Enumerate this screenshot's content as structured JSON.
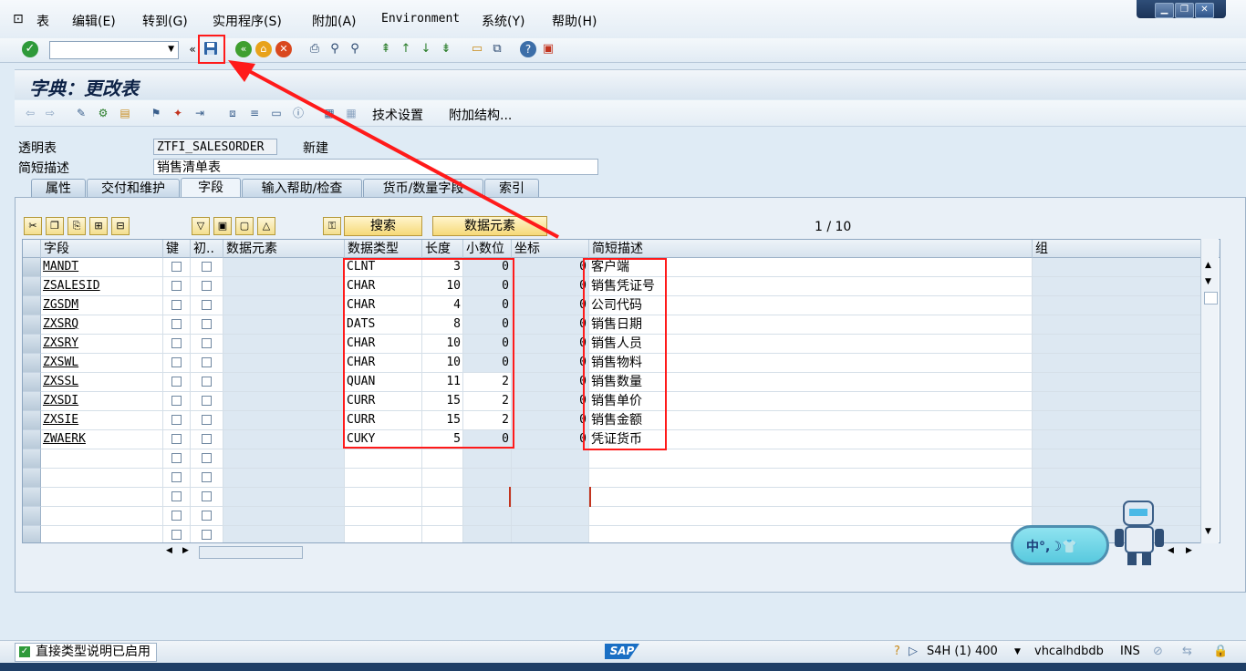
{
  "menubar": {
    "items": [
      "表",
      "编辑(E)",
      "转到(G)",
      "实用程序(S)",
      "附加(A)",
      "Environment",
      "系统(Y)",
      "帮助(H)"
    ]
  },
  "window_controls": {
    "minimize": "▁",
    "restore": "❐",
    "close": "✕"
  },
  "toolbar": {
    "command_field_value": "",
    "icons": [
      "enter-icon",
      "save-icon",
      "back-icon",
      "exit-icon",
      "cancel-icon",
      "print-icon",
      "find-icon",
      "find-next-icon",
      "first-page-icon",
      "prev-page-icon",
      "next-page-icon",
      "last-page-icon",
      "new-session-icon",
      "shortcut-icon",
      "help-icon",
      "customize-layout-icon"
    ]
  },
  "title": {
    "text": "字典：更改表"
  },
  "app_toolbar": {
    "technical_settings": "技术设置",
    "append_structure": "附加结构..."
  },
  "header": {
    "table_label": "透明表",
    "table_name": "ZTFI_SALESORDER",
    "table_status": "新建",
    "desc_label": "简短描述",
    "desc_value": "销售清单表"
  },
  "tabs": [
    "属性",
    "交付和维护",
    "字段",
    "输入帮助/检查",
    "货币/数量字段",
    "索引"
  ],
  "active_tab": "字段",
  "table_toolbar": {
    "search_button": "搜索",
    "data_element_button": "数据元素",
    "pager": "1 / 10"
  },
  "grid": {
    "columns": [
      "字段",
      "键",
      "初..",
      "数据元素",
      "数据类型",
      "长度",
      "小数位",
      "坐标",
      "简短描述",
      "组"
    ],
    "rows": [
      {
        "field": "MANDT",
        "type": "CLNT",
        "length": "3",
        "decimals": "0",
        "coord": "0",
        "desc": "客户端"
      },
      {
        "field": "ZSALESID",
        "type": "CHAR",
        "length": "10",
        "decimals": "0",
        "coord": "0",
        "desc": "销售凭证号"
      },
      {
        "field": "ZGSDM",
        "type": "CHAR",
        "length": "4",
        "decimals": "0",
        "coord": "0",
        "desc": "公司代码"
      },
      {
        "field": "ZXSRQ",
        "type": "DATS",
        "length": "8",
        "decimals": "0",
        "coord": "0",
        "desc": "销售日期"
      },
      {
        "field": "ZXSRY",
        "type": "CHAR",
        "length": "10",
        "decimals": "0",
        "coord": "0",
        "desc": "销售人员"
      },
      {
        "field": "ZXSWL",
        "type": "CHAR",
        "length": "10",
        "decimals": "0",
        "coord": "0",
        "desc": "销售物料"
      },
      {
        "field": "ZXSSL",
        "type": "QUAN",
        "length": "11",
        "decimals": "2",
        "coord": "0",
        "desc": "销售数量"
      },
      {
        "field": "ZXSDI",
        "type": "CURR",
        "length": "15",
        "decimals": "2",
        "coord": "0",
        "desc": "销售单价"
      },
      {
        "field": "ZXSIE",
        "type": "CURR",
        "length": "15",
        "decimals": "2",
        "coord": "0",
        "desc": "销售金额"
      },
      {
        "field": "ZWAERK",
        "type": "CUKY",
        "length": "5",
        "decimals": "0",
        "coord": "0",
        "desc": "凭证货币"
      }
    ],
    "empty_rows": 5
  },
  "ime_widget": {
    "text": "中°,☽👕"
  },
  "statusbar": {
    "message": "直接类型说明已启用",
    "sap_logo": "SAP",
    "system": "S4H (1) 400",
    "host": "vhcalhdbdb",
    "mode": "INS"
  },
  "colors": {
    "annotation_red": "#ff1a1a",
    "title_blue": "#0d2246",
    "panel_bg": "#e9f0f7"
  }
}
